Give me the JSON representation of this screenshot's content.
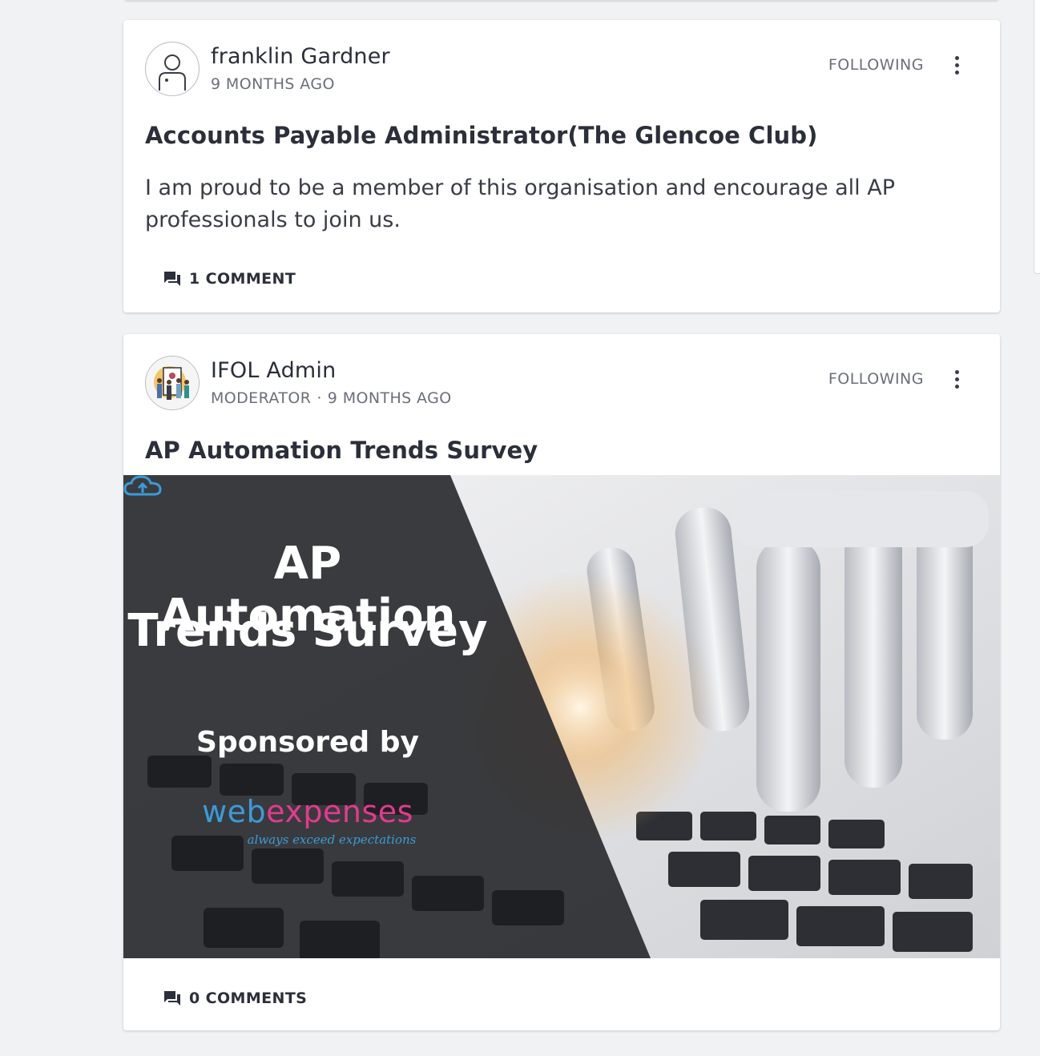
{
  "feed": {
    "posts": [
      {
        "author": "franklin Gardner",
        "role": "",
        "time": "9 MONTHS AGO",
        "follow_label": "FOLLOWING",
        "avatar_icon": "default-user-icon",
        "title": "Accounts Payable Administrator(The Glencoe Club)",
        "body": "I am proud to be a member of this organisation and encourage all AP professionals to join us.",
        "comments_label": "1 COMMENT"
      },
      {
        "author": "IFOL Admin",
        "role": "MODERATOR",
        "separator": "·",
        "time": "9 MONTHS AGO",
        "follow_label": "FOLLOWING",
        "avatar_icon": "group-illustration-avatar",
        "title": "AP Automation Trends Survey",
        "banner": {
          "line1": "AP Automation",
          "line2": "Trends Survey",
          "sponsored": "Sponsored by",
          "brand_web": "web",
          "brand_expenses": "expenses",
          "tagline": "always exceed expectations"
        },
        "comments_label": "0 COMMENTS"
      }
    ]
  },
  "colors": {
    "page_bg": "#f1f2f4",
    "card_bg": "#ffffff",
    "text": "#2b2f3a",
    "muted": "#6b6f78",
    "brand_blue": "#3a9bd9",
    "brand_pink": "#e4398e"
  }
}
